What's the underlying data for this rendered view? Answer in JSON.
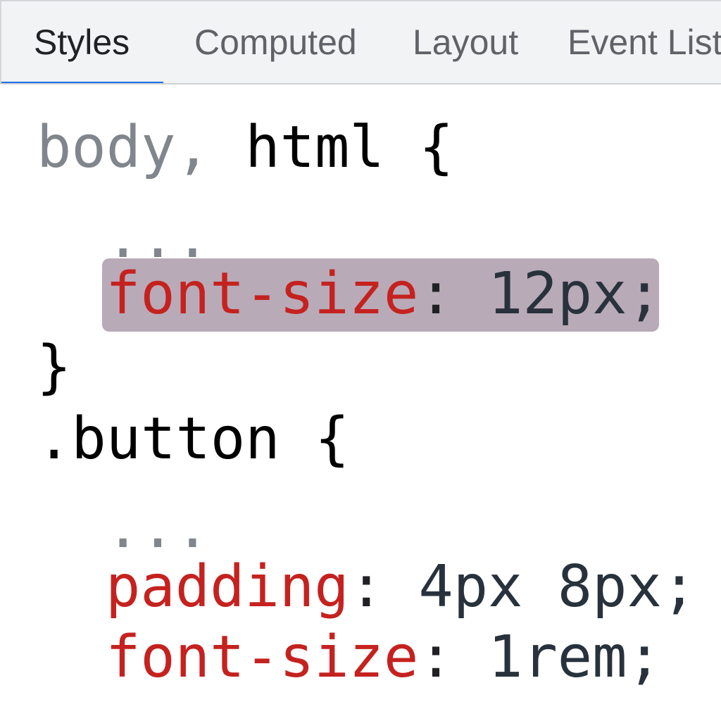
{
  "tabs": [
    {
      "label": "Styles",
      "active": true
    },
    {
      "label": "Computed",
      "active": false
    },
    {
      "label": "Layout",
      "active": false
    },
    {
      "label": "Event Listeners",
      "active": false
    }
  ],
  "colors": {
    "accent": "#1a73e8",
    "property": "#c5221f",
    "value": "#28323c",
    "dimmed": "#80868b",
    "highlight": "#b9aab8"
  },
  "rules": [
    {
      "selector_dim": "body,",
      "selector": " html {",
      "ellipsis": "...",
      "declarations": [
        {
          "property": "font-size",
          "colon": ":",
          "value": " 12px;",
          "highlighted": true
        }
      ],
      "close": "}"
    },
    {
      "selector": ".button {",
      "ellipsis": "...",
      "declarations": [
        {
          "property": "padding",
          "colon": ":",
          "value": " 4px 8px;",
          "highlighted": false
        },
        {
          "property": "font-size",
          "colon": ":",
          "value": " 1rem;",
          "highlighted": false
        }
      ]
    }
  ]
}
